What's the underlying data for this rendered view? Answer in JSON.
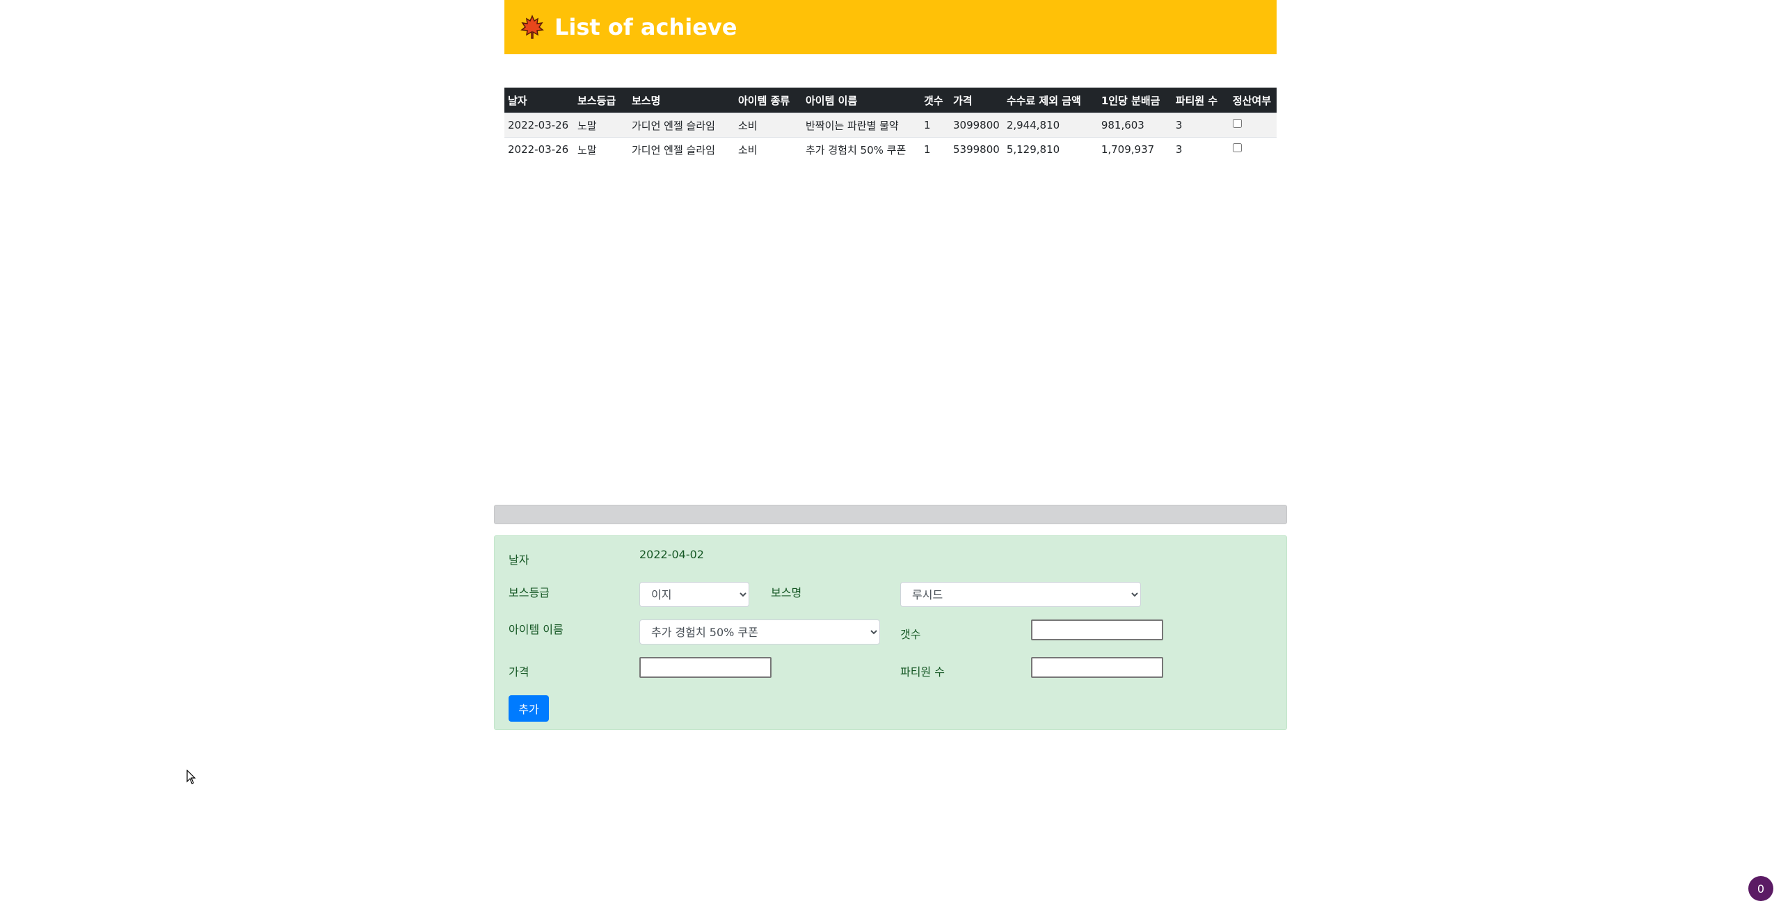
{
  "header": {
    "title": "List of achieve",
    "logo_icon": "maple-leaf-icon",
    "color": "#ffc107"
  },
  "table": {
    "columns": [
      "날자",
      "보스등급",
      "보스명",
      "아이템 종류",
      "아이템 이름",
      "갯수",
      "가격",
      "수수료 제외 금액",
      "1인당 분배금",
      "파티원 수",
      "정산여부"
    ],
    "rows": [
      [
        "2022-03-26",
        "노말",
        "가디언 엔젤 슬라임",
        "소비",
        "반짝이는 파란별 물약",
        "1",
        "3099800",
        "2,944,810",
        "981,603",
        "3"
      ],
      [
        "2022-03-26",
        "노말",
        "가디언 엔젤 슬라임",
        "소비",
        "추가 경험치 50% 쿠폰",
        "1",
        "5399800",
        "5,129,810",
        "1,709,937",
        "3"
      ]
    ],
    "settled": [
      false,
      false
    ]
  },
  "form": {
    "date_label": "날자",
    "date_value": "2022-04-02",
    "boss_grade_label": "보스등급",
    "boss_grade_value": "이지",
    "boss_name_label": "보스명",
    "boss_name_value": "루시드",
    "item_name_label": "아이템 이름",
    "item_name_value": "추가 경험치 50% 쿠폰",
    "count_label": "갯수",
    "count_value": "",
    "price_label": "가격",
    "price_value": "",
    "party_label": "파티원 수",
    "party_value": "",
    "add_button": "추가"
  },
  "badge": {
    "count": "0"
  }
}
